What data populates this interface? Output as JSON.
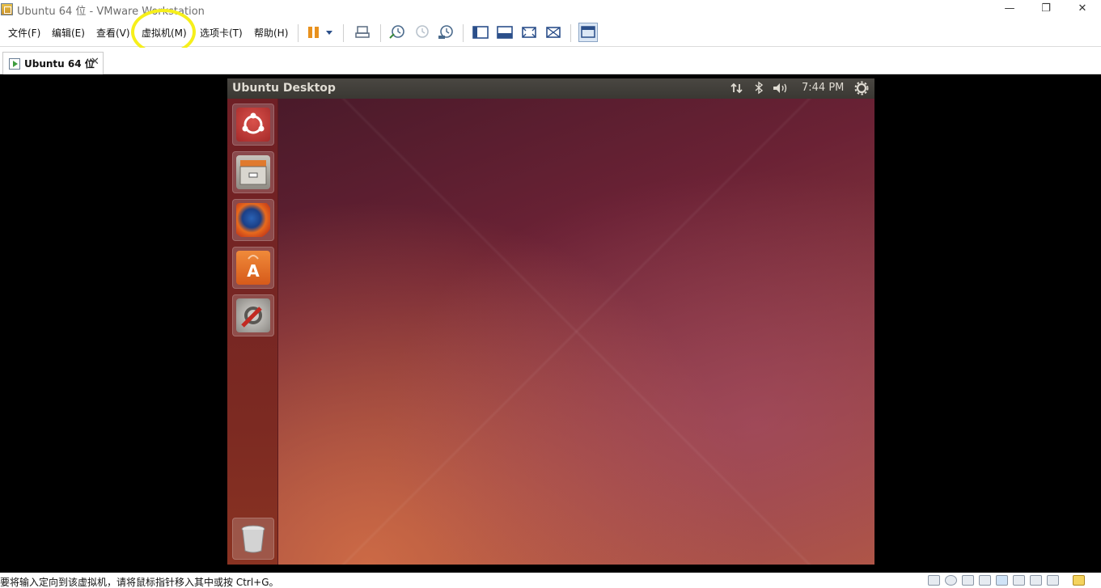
{
  "window": {
    "title": "Ubuntu 64 位 - VMware Workstation",
    "controls": {
      "minimize": "—",
      "restore": "❐",
      "close": "✕"
    }
  },
  "menu": {
    "items": [
      "文件(F)",
      "编辑(E)",
      "查看(V)",
      "虚拟机(M)",
      "选项卡(T)",
      "帮助(H)"
    ],
    "highlighted": "虚拟机(M)",
    "highlight_color": "#f6ef1b"
  },
  "toolbar": {
    "icons": [
      "pause-icon",
      "dropdown-arrow-icon",
      "send-ctrl-alt-del-icon",
      "snapshot-take-icon",
      "snapshot-revert-icon",
      "snapshot-manager-icon",
      "library-view-icon",
      "console-view-icon",
      "fullscreen-icon",
      "unity-icon",
      "thumbnail-view-icon"
    ],
    "pause_color": "#e8911e"
  },
  "tab": {
    "label": "Ubuntu 64 位",
    "close": "✕"
  },
  "vm": {
    "panel_title": "Ubuntu Desktop",
    "clock": "7:44 PM",
    "indicators": [
      "network-icon",
      "bluetooth-icon",
      "volume-icon",
      "settings-gear-icon"
    ],
    "launcher": [
      "ubuntu-dash-icon",
      "files-icon",
      "firefox-icon",
      "software-center-icon",
      "system-settings-icon",
      "trash-icon"
    ]
  },
  "statusbar": {
    "message": "要将输入定向到该虚拟机，请将鼠标指针移入其中或按 Ctrl+G。",
    "icons": [
      "hard-disk-icon",
      "cd-dvd-icon",
      "network-adapter-icon",
      "printer-icon",
      "usb-icon",
      "sound-card-icon",
      "camera-icon",
      "display-icon",
      "message-icon"
    ]
  }
}
